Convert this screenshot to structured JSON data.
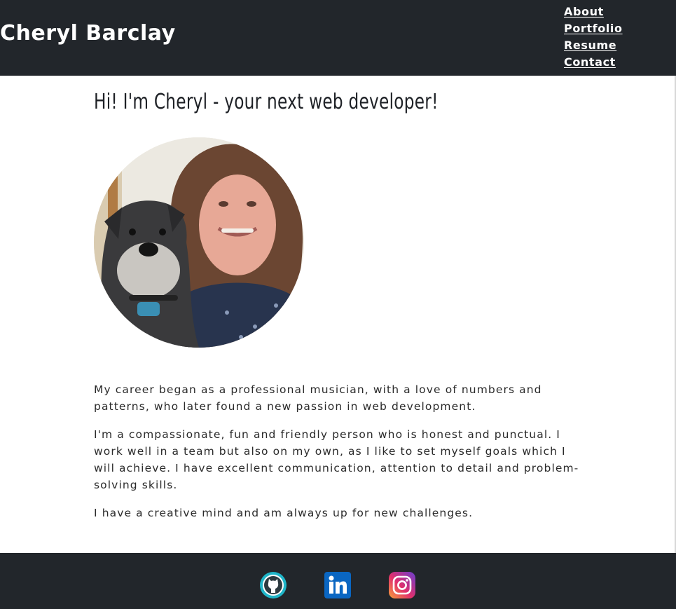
{
  "header": {
    "site_title": "Cheryl Barclay",
    "nav": [
      {
        "label": "About"
      },
      {
        "label": "Portfolio"
      },
      {
        "label": "Resume"
      },
      {
        "label": "Contact"
      }
    ]
  },
  "main": {
    "heading": "Hi! I'm Cheryl - your next web developer!",
    "paragraphs": [
      "My career began as a professional musician, with a love of numbers and patterns, who later found a new passion in web development.",
      "I'm a compassionate, fun and friendly person who is honest and punctual. I work well in a team but also on my own, as I like to set myself goals which I will achieve. I have excellent communication, attention to detail and problem-solving skills.",
      "I have a creative mind and am always up for new challenges."
    ]
  },
  "footer": {
    "social": [
      {
        "icon": "github-icon"
      },
      {
        "icon": "linkedin-icon"
      },
      {
        "icon": "instagram-icon"
      }
    ]
  },
  "colors": {
    "header_bg": "#22262b",
    "footer_bg": "#22262b",
    "text": "#2a2a2a",
    "github": "#1fb5c8",
    "linkedin": "#0a66c2"
  }
}
